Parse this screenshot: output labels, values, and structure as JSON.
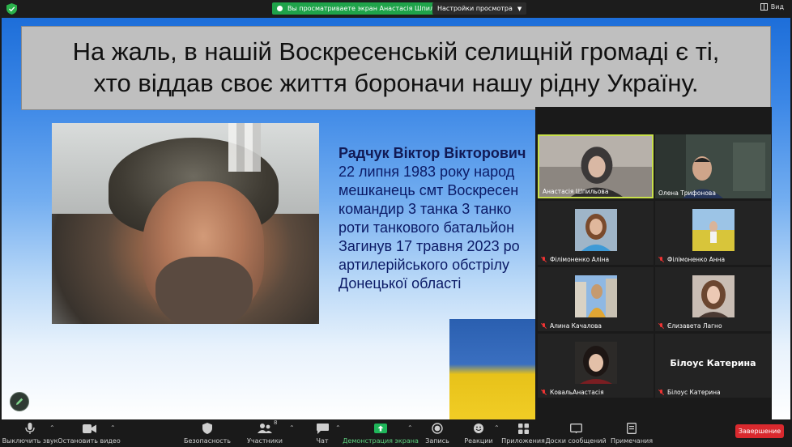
{
  "topbar": {
    "share_banner": "Вы просматриваете экран Анастасія Шпильова",
    "view_settings": "Настройки просмотра",
    "view_button": "Вид"
  },
  "slide": {
    "title_line1": "На жаль,  в нашій Воскресенській селищній громаді є ті,",
    "title_line2": "хто віддав своє життя бороначи нашу рідну Україну.",
    "bio_lines": [
      "Радчук Віктор Вікторович",
      "22 липня 1983 року народ",
      "мешканець смт Воскресен",
      "командир 3 танка 3 танко",
      "роти танкового батальйон",
      "Загинув 17 травня 2023 ро",
      "артилерійського обстрілу",
      "Донецької області"
    ]
  },
  "participants": [
    {
      "name": "Анастасія Шпильова",
      "muted": false
    },
    {
      "name": "Олена Трифонова",
      "muted": false
    },
    {
      "name": "Філімоненко Аліна",
      "muted": true
    },
    {
      "name": "Філімоненко Анна",
      "muted": true
    },
    {
      "name": "Алина Качалова",
      "muted": true
    },
    {
      "name": "Єлизавета Лагно",
      "muted": true
    },
    {
      "name": "КовальАнастасія",
      "muted": true
    },
    {
      "name": "Білоус Катерина",
      "muted": true,
      "display_name": "Білоус Катерина"
    }
  ],
  "toolbar": {
    "mute": "Выключить звук",
    "stop_video": "Остановить видео",
    "security": "Безопасность",
    "participants": "Участники",
    "participants_count": "8",
    "chat": "Чат",
    "share_screen": "Демонстрация экрана",
    "record": "Запись",
    "reactions": "Реакции",
    "apps": "Приложения",
    "whiteboards": "Доски сообщений",
    "notes": "Примечания",
    "end": "Завершение"
  },
  "colors": {
    "share_green": "#1fa34a",
    "end_red": "#d9292e",
    "active_speaker": "#c8e04a"
  }
}
